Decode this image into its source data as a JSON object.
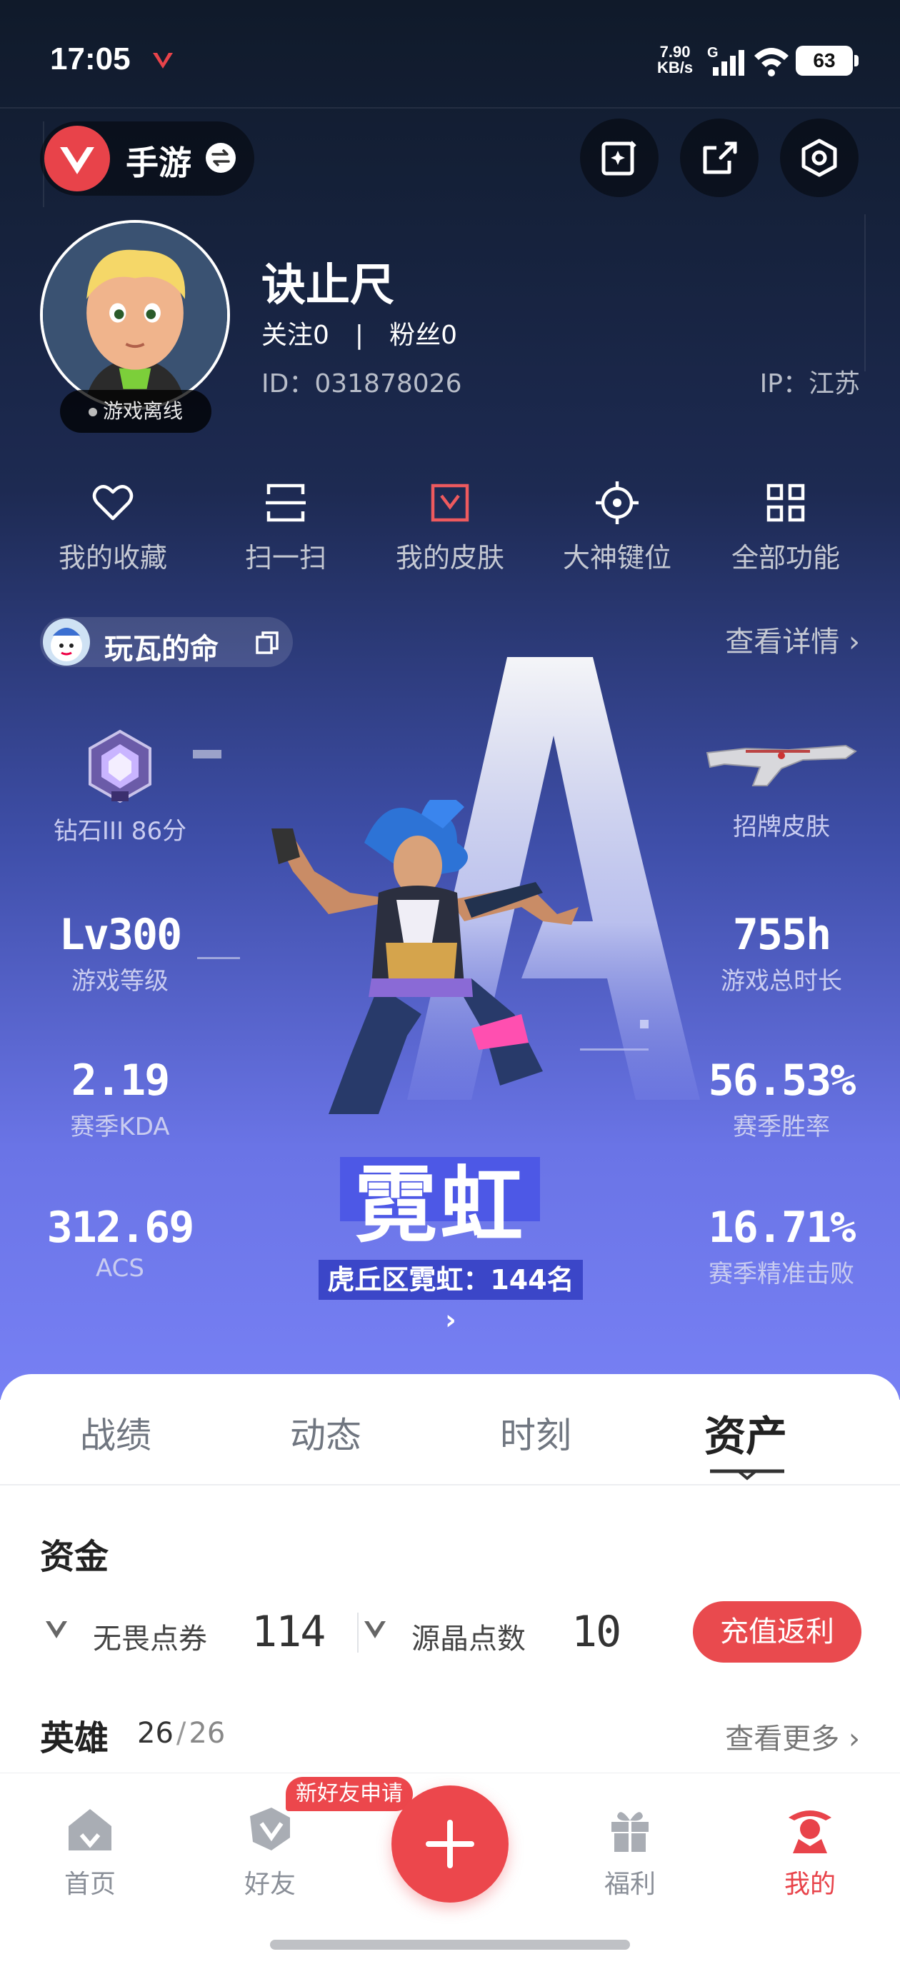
{
  "status_bar": {
    "time": "17:05",
    "net_speed_value": "7.90",
    "net_speed_unit": "KB/s",
    "net_type": "G",
    "battery": "63"
  },
  "top_bar": {
    "switch_label": "手游"
  },
  "profile": {
    "nickname": "诀止尺",
    "following_label": "关注",
    "following_count": "0",
    "followers_label": "粉丝",
    "followers_count": "0",
    "separator": "|",
    "id_text": "ID：031878026",
    "ip_text": "IP：江苏",
    "online_status": "游戏离线"
  },
  "quick_actions": [
    {
      "label": "我的收藏",
      "icon": "heart-icon"
    },
    {
      "label": "扫一扫",
      "icon": "scan-icon"
    },
    {
      "label": "我的皮肤",
      "icon": "skin-icon"
    },
    {
      "label": "大神键位",
      "icon": "crosshair-icon"
    },
    {
      "label": "全部功能",
      "icon": "grid-icon"
    }
  ],
  "game_card": {
    "account_name": "玩瓦的命",
    "view_detail": "查看详情",
    "rank_text": "钻石III 86分",
    "signature_skin": "招牌皮肤",
    "level_value": "Lv300",
    "level_label": "游戏等级",
    "playtime_value": "755h",
    "playtime_label": "游戏总时长",
    "kda_value": "2.19",
    "kda_label": "赛季KDA",
    "winrate_value": "56.53%",
    "winrate_label": "赛季胜率",
    "acs_value": "312.69",
    "acs_label": "ACS",
    "headshot_value": "16.71%",
    "headshot_label": "赛季精准击败",
    "agent_name": "霓虹",
    "agent_rank": "虎丘区霓虹：144名",
    "agent_letter": "A",
    "accent": "#6a74e6"
  },
  "tabs": [
    {
      "label": "战绩"
    },
    {
      "label": "动态"
    },
    {
      "label": "时刻"
    },
    {
      "label": "资产"
    }
  ],
  "assets": {
    "funds_title": "资金",
    "vp_label": "无畏点券",
    "vp_value": "114",
    "rp_label": "源晶点数",
    "rp_value": "10",
    "recharge_button": "充值返利",
    "heroes_title": "英雄",
    "heroes_owned": "26",
    "heroes_slash": "/",
    "heroes_total": "26",
    "view_more": "查看更多"
  },
  "bottom_nav": {
    "items": [
      {
        "label": "首页",
        "icon": "home-icon"
      },
      {
        "label": "好友",
        "icon": "friends-icon"
      },
      {
        "label": "福利",
        "icon": "gift-icon"
      },
      {
        "label": "我的",
        "icon": "profile-icon"
      }
    ],
    "friend_badge": "新好友申请",
    "active_color": "#e8434a"
  }
}
